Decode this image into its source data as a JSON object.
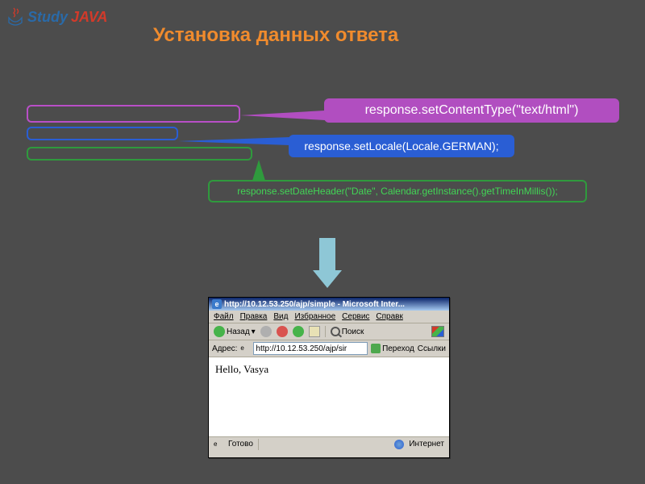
{
  "logo": {
    "study": "Study",
    "java": "JAVA"
  },
  "title": "Установка данных ответа",
  "callouts": {
    "purple": "response.setContentType(\"text/html\")",
    "blue": "response.setLocale(Locale.GERMAN);",
    "green": "response.setDateHeader(\"Date\", Calendar.getInstance().getTimeInMillis());"
  },
  "browser": {
    "title": "http://10.12.53.250/ajp/simple - Microsoft Inter...",
    "menu": [
      "Файл",
      "Правка",
      "Вид",
      "Избранное",
      "Сервис",
      "Справк"
    ],
    "back": "Назад",
    "search": "Поиск",
    "addr_label": "Адрес:",
    "addr_value": "http://10.12.53.250/ajp/sir",
    "go": "Переход",
    "links": "Ссылки",
    "content": "Hello, Vasya",
    "status_ready": "Готово",
    "status_net": "Интернет"
  }
}
